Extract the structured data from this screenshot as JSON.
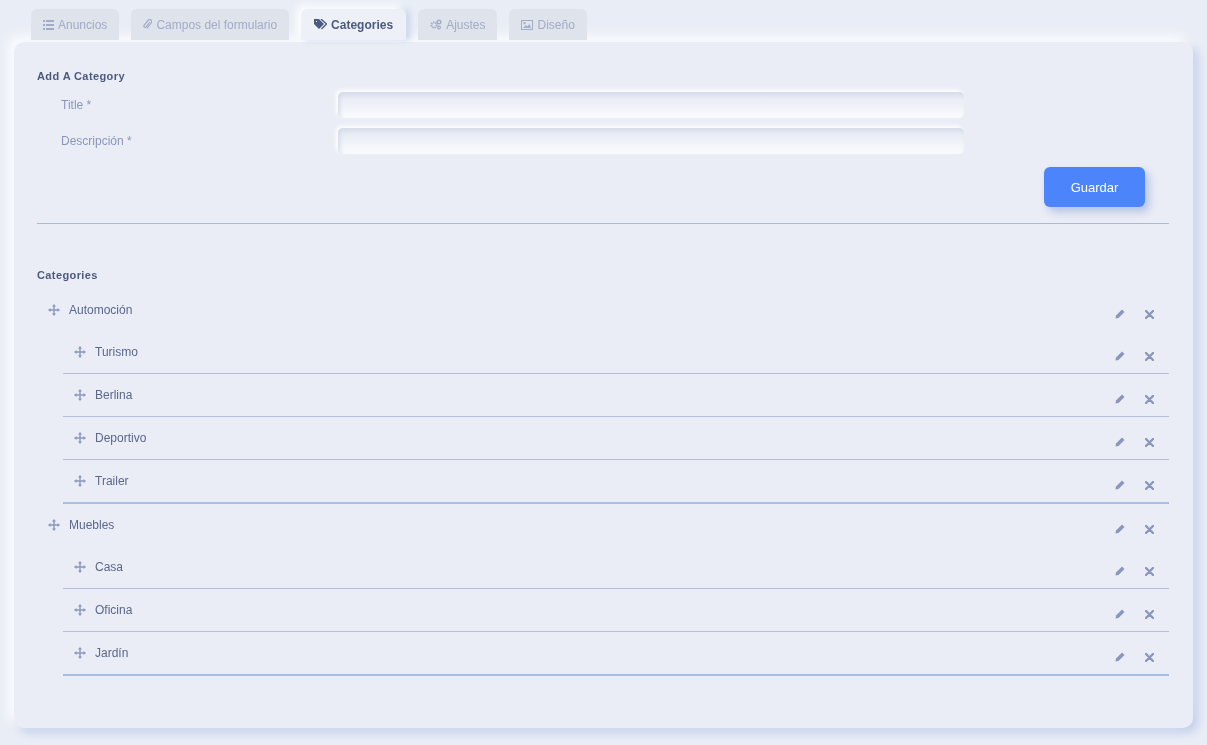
{
  "tabs": [
    {
      "label": "Anuncios",
      "kind": "list",
      "selected": false
    },
    {
      "label": "Campos del formulario",
      "kind": "clip",
      "selected": false
    },
    {
      "label": "Categories",
      "kind": "tags",
      "selected": true
    },
    {
      "label": "Ajustes",
      "kind": "cogs",
      "selected": false
    },
    {
      "label": "Diseño",
      "kind": "image",
      "selected": false
    }
  ],
  "form": {
    "heading": "Add A Category",
    "fields": [
      {
        "label": "Title *"
      },
      {
        "label": "Descripción *"
      }
    ],
    "submit": "Guardar"
  },
  "categories": {
    "heading": "Categories",
    "items": [
      {
        "name": "Automoción",
        "children": [
          {
            "name": "Turismo"
          },
          {
            "name": "Berlina"
          },
          {
            "name": "Deportivo"
          },
          {
            "name": "Trailer"
          }
        ]
      },
      {
        "name": "Muebles",
        "children": [
          {
            "name": "Casa"
          },
          {
            "name": "Oficina"
          },
          {
            "name": "Jardín"
          }
        ]
      }
    ]
  }
}
